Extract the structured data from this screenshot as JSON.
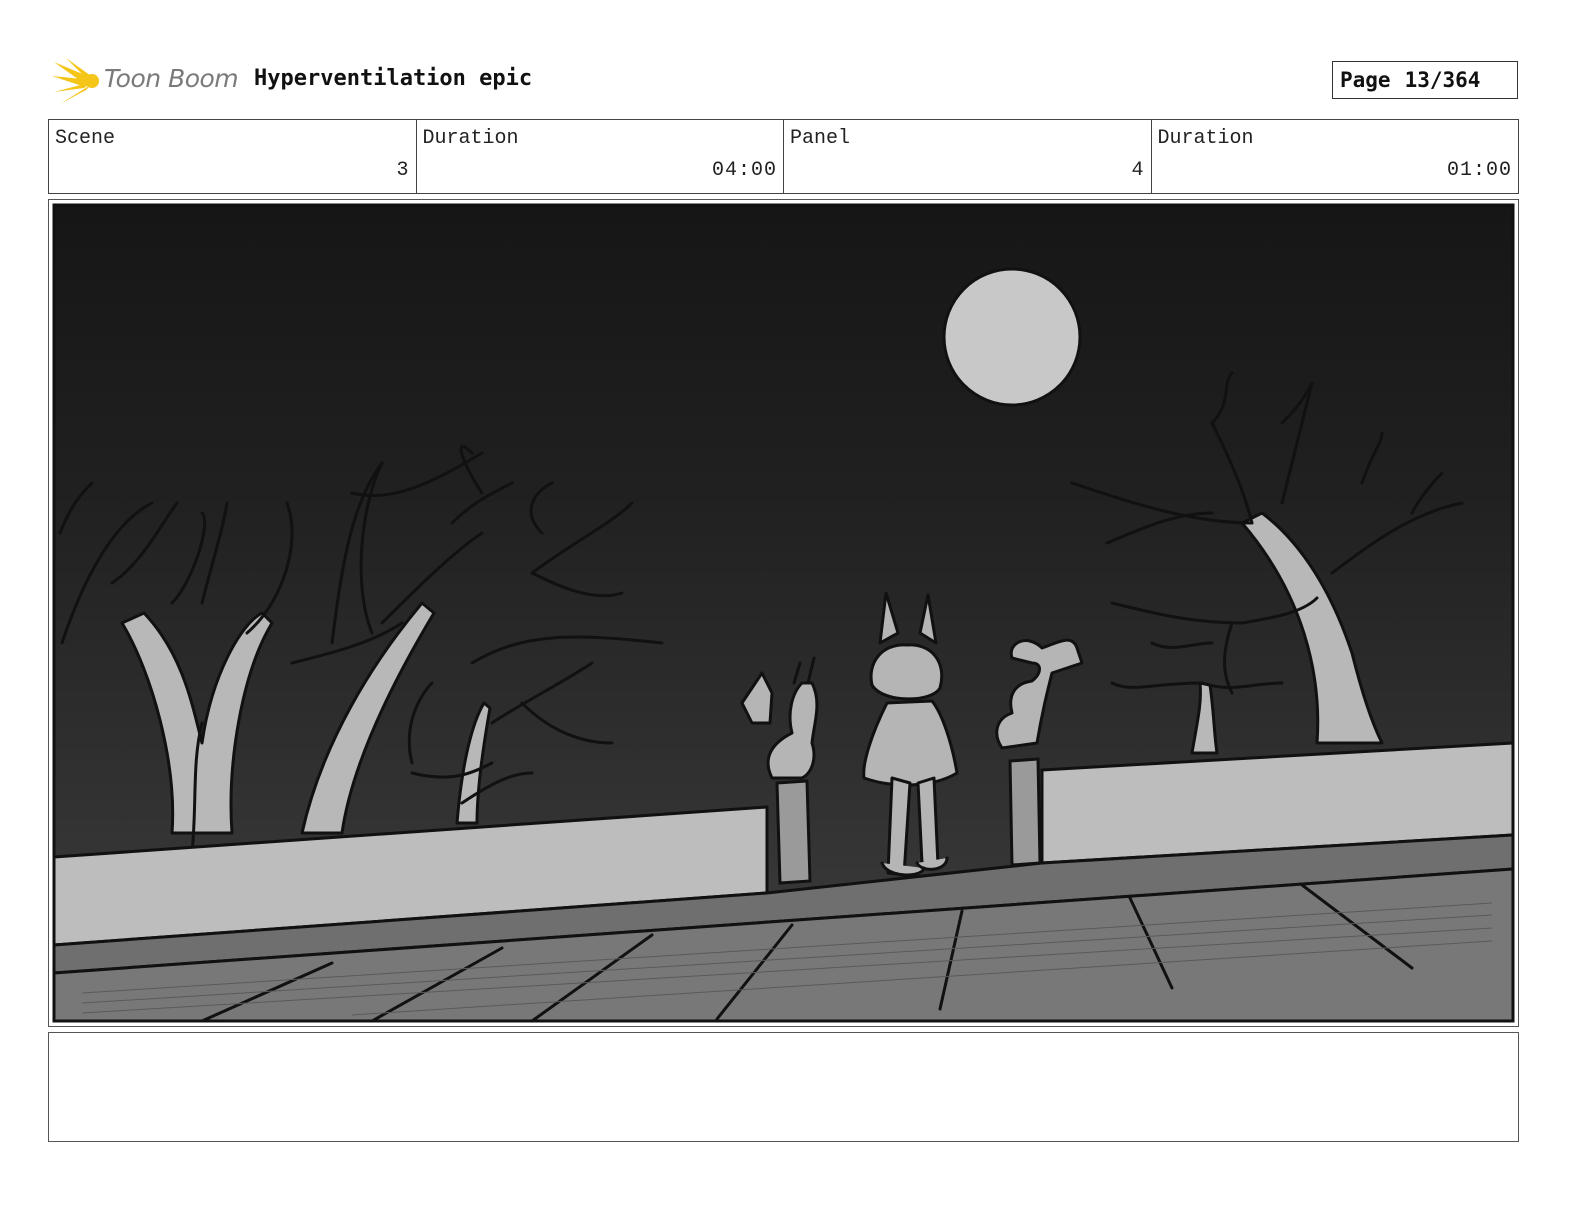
{
  "header": {
    "brand": "Toon Boom",
    "project_title": "Hyperventilation epic",
    "page_label": "Page",
    "page_value": "13/364"
  },
  "info": {
    "scene_label": "Scene",
    "scene_value": "3",
    "scene_duration_label": "Duration",
    "scene_duration_value": "04:00",
    "panel_label": "Panel",
    "panel_value": "4",
    "panel_duration_label": "Duration",
    "panel_duration_value": "01:00"
  },
  "colors": {
    "logo_accent": "#f5c518",
    "sky_top": "#181818",
    "sky_bottom": "#3c3c3c",
    "moon": "#c8c8c8",
    "wall": "#bdbdbd",
    "ground": "#7a7a7a"
  },
  "icons": {
    "logo": "toon-boom-burst-icon"
  },
  "notes": ""
}
